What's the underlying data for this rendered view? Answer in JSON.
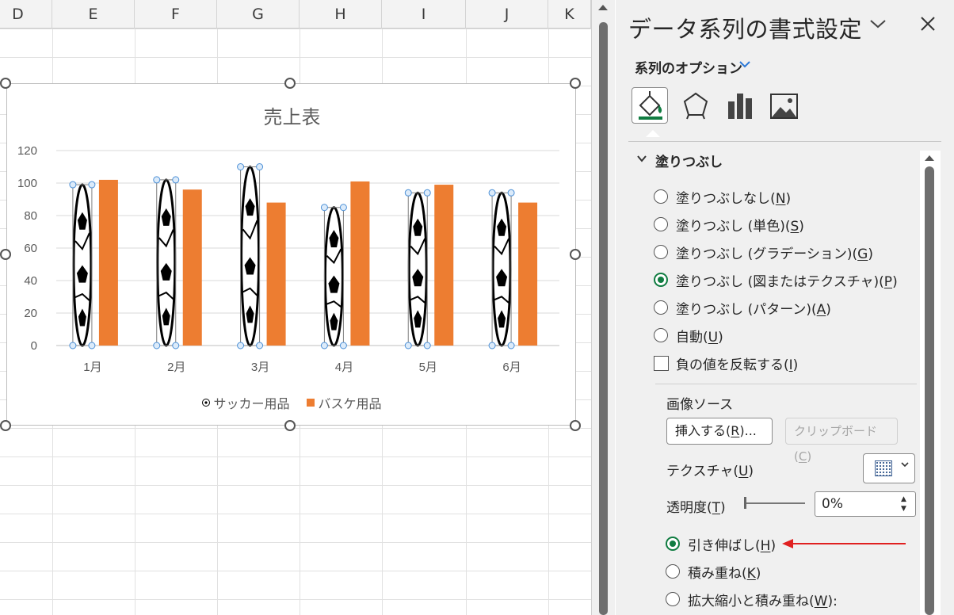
{
  "sheet": {
    "columns": [
      "D",
      "E",
      "F",
      "G",
      "H",
      "I",
      "J",
      "K"
    ]
  },
  "chart": {
    "title": "売上表",
    "legend": {
      "soccer": "サッカー用品",
      "basket": "バスケ用品"
    }
  },
  "chart_data": {
    "type": "bar",
    "title": "売上表",
    "categories": [
      "1月",
      "2月",
      "3月",
      "4月",
      "5月",
      "6月"
    ],
    "series": [
      {
        "name": "サッカー用品",
        "values": [
          99,
          102,
          110,
          85,
          94,
          94
        ],
        "fill": "picture-soccer-ball"
      },
      {
        "name": "バスケ用品",
        "values": [
          102,
          96,
          88,
          101,
          99,
          88
        ],
        "color": "#ed7d31"
      }
    ],
    "ylim": [
      0,
      120
    ],
    "yticks": [
      0,
      20,
      40,
      60,
      80,
      100,
      120
    ],
    "grid": true,
    "legend_position": "bottom"
  },
  "pane": {
    "title": "データ系列の書式設定",
    "series_options": "系列のオプション",
    "tabs": [
      "fill-line",
      "effects",
      "series-options",
      "picture"
    ],
    "fill_section": "塗りつぶし",
    "fill_options": [
      {
        "text": "塗りつぶしなし(",
        "key": "N",
        "tail": ")",
        "selected": false
      },
      {
        "text": "塗りつぶし (単色)(",
        "key": "S",
        "tail": ")",
        "selected": false
      },
      {
        "text": "塗りつぶし (グラデーション)(",
        "key": "G",
        "tail": ")",
        "selected": false
      },
      {
        "text": "塗りつぶし (図またはテクスチャ)(",
        "key": "P",
        "tail": ")",
        "selected": true
      },
      {
        "text": "塗りつぶし (パターン)(",
        "key": "A",
        "tail": ")",
        "selected": false
      },
      {
        "text": "自動(",
        "key": "U",
        "tail": ")",
        "selected": false
      }
    ],
    "invert": {
      "text": "負の値を反転する(",
      "key": "I",
      "tail": ")",
      "checked": false
    },
    "image_source": "画像ソース",
    "insert_btn": {
      "text": "挿入する(",
      "key": "R",
      "tail": ")..."
    },
    "clipboard_btn": {
      "text": "クリップボード(",
      "key": "C",
      "tail": ")"
    },
    "texture": {
      "text": "テクスチャ(",
      "key": "U",
      "tail": ")"
    },
    "transparency": {
      "text": "透明度(",
      "key": "T",
      "tail": ")"
    },
    "transparency_value": "0%",
    "stretch_options": [
      {
        "text": "引き伸ばし(",
        "key": "H",
        "tail": ")",
        "selected": true
      },
      {
        "text": "積み重ね(",
        "key": "K",
        "tail": ")",
        "selected": false
      },
      {
        "text": "拡大縮小と積み重ね(",
        "key": "W",
        "tail": "):",
        "selected": false
      }
    ],
    "accent_color": "#107c41",
    "arrow_color": "#e02020"
  }
}
